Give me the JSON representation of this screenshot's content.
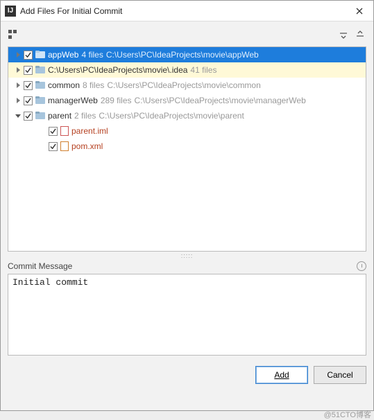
{
  "titlebar": {
    "title": "Add Files For Initial Commit"
  },
  "tree": {
    "items": [
      {
        "depth": 0,
        "arrow": "right",
        "checked": true,
        "icon": "folder",
        "name": "appWeb",
        "count": "4 files",
        "path": "C:\\Users\\PC\\IdeaProjects\\movie\\appWeb",
        "selected": true
      },
      {
        "depth": 0,
        "arrow": "right",
        "checked": true,
        "icon": "folder",
        "name": "C:\\Users\\PC\\IdeaProjects\\movie\\.idea",
        "count": "41 files",
        "path": "",
        "highlight": true
      },
      {
        "depth": 0,
        "arrow": "right",
        "checked": true,
        "icon": "folder",
        "name": "common",
        "count": "8 files",
        "path": "C:\\Users\\PC\\IdeaProjects\\movie\\common"
      },
      {
        "depth": 0,
        "arrow": "right",
        "checked": true,
        "icon": "folder",
        "name": "managerWeb",
        "count": "289 files",
        "path": "C:\\Users\\PC\\IdeaProjects\\movie\\managerWeb"
      },
      {
        "depth": 0,
        "arrow": "down",
        "checked": true,
        "icon": "folder",
        "name": "parent",
        "count": "2 files",
        "path": "C:\\Users\\PC\\IdeaProjects\\movie\\parent"
      },
      {
        "depth": 2,
        "arrow": "none",
        "checked": true,
        "icon": "file-iml",
        "name": "parent.iml",
        "filelink": true
      },
      {
        "depth": 2,
        "arrow": "none",
        "checked": true,
        "icon": "file-xml",
        "name": "pom.xml",
        "filelink": true
      }
    ]
  },
  "commit": {
    "label": "Commit Message",
    "value": "Initial commit"
  },
  "buttons": {
    "add": "Add",
    "cancel": "Cancel"
  },
  "watermark": "@51CTO博客"
}
